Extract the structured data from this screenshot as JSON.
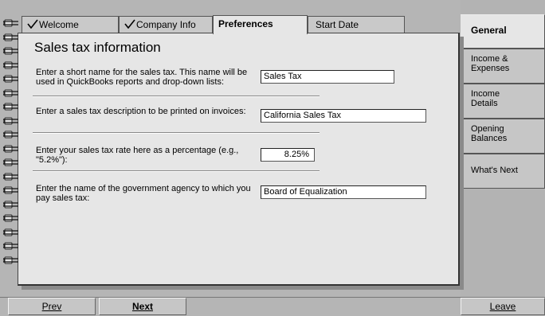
{
  "tabs": [
    {
      "label": "Welcome",
      "checked": true
    },
    {
      "label": "Company Info",
      "checked": true
    },
    {
      "label": "Preferences",
      "checked": false,
      "active": true
    },
    {
      "label": "Start Date",
      "checked": false
    }
  ],
  "main": {
    "title": "Sales tax information",
    "rows": [
      {
        "label": "Enter a short name for the sales tax. This name will be used in QuickBooks reports and drop-down lists:",
        "value": "Sales Tax"
      },
      {
        "label": "Enter a sales tax description to be printed on invoices:",
        "value": "California Sales Tax"
      },
      {
        "label": "Enter your sales tax rate here as a percentage (e.g., \"5.2%\"):",
        "value": "8.25%"
      },
      {
        "label": "Enter the name of the government agency to which you pay sales tax:",
        "value": "Board of Equalization"
      }
    ]
  },
  "side_tabs": [
    {
      "label": "General",
      "active": true
    },
    {
      "label": "Income & Expenses"
    },
    {
      "label": "Income Details"
    },
    {
      "label": "Opening Balances"
    },
    {
      "label": "What's Next"
    }
  ],
  "bottom": {
    "prev": "Prev",
    "next": "Next",
    "leave": "Leave"
  },
  "colors": {
    "panel": "#e6e6e6",
    "background": "#b5b5b5",
    "tab": "#c9c9c9"
  }
}
